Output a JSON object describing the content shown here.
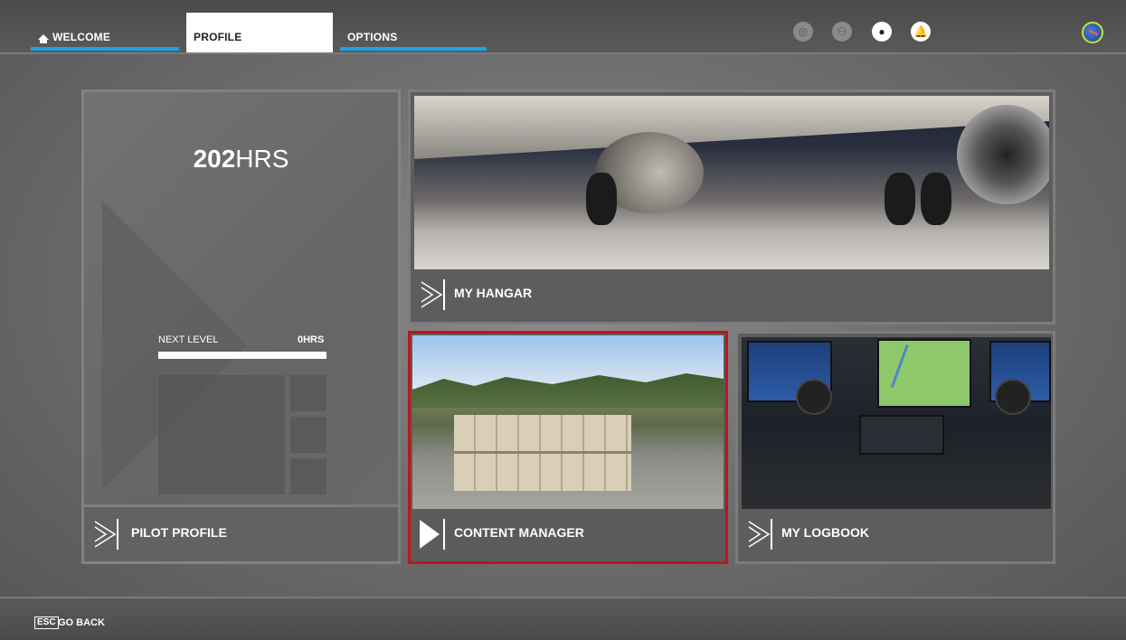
{
  "nav": {
    "tabs": [
      {
        "label": "WELCOME"
      },
      {
        "label": "PROFILE"
      },
      {
        "label": "OPTIONS"
      }
    ],
    "icons": [
      "activity-icon",
      "friends-icon",
      "user-icon",
      "notification-icon"
    ],
    "accent_color": "#1aa3e8"
  },
  "pilot": {
    "hours_value": "202",
    "hours_unit": "HRS",
    "next_level_label": "NEXT LEVEL",
    "next_level_hours": "0HRS",
    "progress": 1.0,
    "title": "PILOT PROFILE"
  },
  "cards": {
    "hangar": "MY HANGAR",
    "content_manager": "CONTENT MANAGER",
    "logbook": "MY LOGBOOK"
  },
  "selected_color": "#c0141b",
  "footer": {
    "esc_key": "ESC",
    "go_back": "GO BACK"
  }
}
